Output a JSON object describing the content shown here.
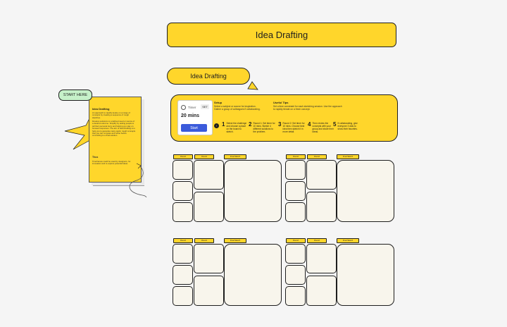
{
  "page_title": "Idea Drafting",
  "section_title": "Idea Drafting",
  "start_here": "START HERE",
  "timer": {
    "label": "Timer",
    "set_label": "SET",
    "duration": "20 mins",
    "start_label": "Start"
  },
  "setup": {
    "heading": "Setup",
    "text": "Select a subject or source for inspiration. Gather a group of colleagues if collaborating."
  },
  "tips": {
    "heading": "Useful Tips",
    "text": "Set a time constraint for each sketching session. Use the approach to rapidly iterate on a fresh concept."
  },
  "steps": [
    {
      "num": "1",
      "text": "Select the challenge and choose a place on the board to sketch."
    },
    {
      "num": "2",
      "text": "Round 1: Set timer for 10 mins. Sketch 4 different solutions to the problem."
    },
    {
      "num": "3",
      "text": "Round 2: Set timer for 10 mins. Choose best idea then sketch it in more detail."
    },
    {
      "num": "4",
      "text": "Then review the concepts with your group and share their ideas."
    },
    {
      "num": "5",
      "text": "If collaborating, give everyone 3 dots to show their favorites."
    }
  ],
  "note": {
    "heading": "Idea Drafting",
    "body1": "An approach to rapidly iterate on a range of concepts by creating a sequence of rough sketches.",
    "body2": "Develop solutions to a defined need or source of a desired outcome. Simplify by asking people to tell their personal story and helping you stay on focused responses. The aim of Idea Drafting is to help you to generate many quick, rough concepts that you can compare and refine before committing to a final solution.",
    "tips_heading": "Thus",
    "tips_body": "Timeframes could be used by designers, for innovation and to explore potential ideas."
  },
  "label_round": "Round",
  "label_final": "Final Sketch",
  "colors": {
    "accent": "#ffd62b",
    "start_here": "#c6f1c9",
    "button": "#3b5bdb",
    "canvas": "#f5f5f5"
  }
}
